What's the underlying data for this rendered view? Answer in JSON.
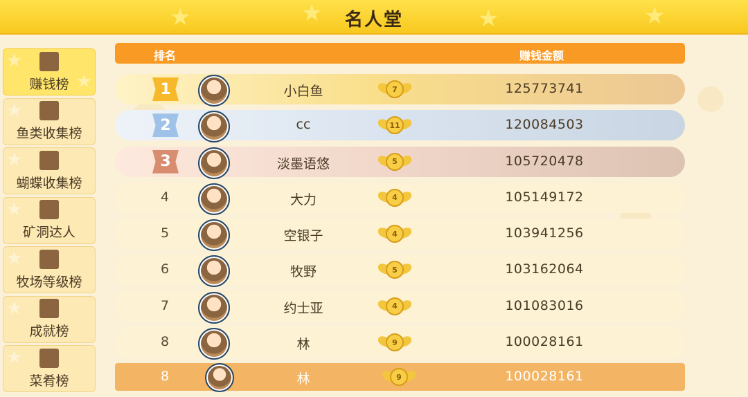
{
  "header": {
    "title": "名人堂"
  },
  "sidebar": {
    "items": [
      {
        "label": "赚钱榜",
        "active": true
      },
      {
        "label": "鱼类收集榜",
        "active": false
      },
      {
        "label": "蝴蝶收集榜",
        "active": false
      },
      {
        "label": "矿洞达人",
        "active": false
      },
      {
        "label": "牧场等级榜",
        "active": false
      },
      {
        "label": "成就榜",
        "active": false
      },
      {
        "label": "菜肴榜",
        "active": false
      }
    ]
  },
  "table": {
    "rank_header": "排名",
    "money_header": "赚钱金额"
  },
  "rows": [
    {
      "rank": "1",
      "name": "小白鱼",
      "level": "7",
      "money": "125773741"
    },
    {
      "rank": "2",
      "name": "cc",
      "level": "11",
      "money": "120084503"
    },
    {
      "rank": "3",
      "name": "淡墨语悠",
      "level": "5",
      "money": "105720478"
    },
    {
      "rank": "4",
      "name": "大力",
      "level": "4",
      "money": "105149172"
    },
    {
      "rank": "5",
      "name": "空银子",
      "level": "4",
      "money": "103941256"
    },
    {
      "rank": "6",
      "name": "牧野",
      "level": "5",
      "money": "103162064"
    },
    {
      "rank": "7",
      "name": "约士亚",
      "level": "4",
      "money": "101083016"
    },
    {
      "rank": "8",
      "name": "林",
      "level": "9",
      "money": "100028161"
    }
  ],
  "self": {
    "rank": "8",
    "name": "林",
    "level": "9",
    "money": "100028161"
  },
  "colors": {
    "header": "#f8c91f",
    "table_header": "#f99a24",
    "self_row": "#f3b563",
    "gold": "#f7b92a",
    "silver": "#9fc2e8",
    "bronze": "#d98d70"
  }
}
